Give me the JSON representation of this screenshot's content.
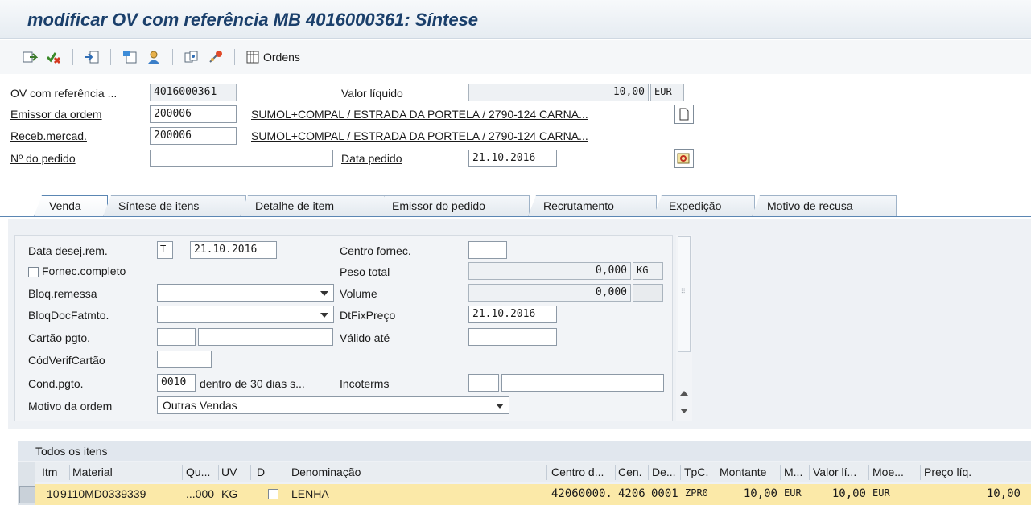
{
  "title": "modificar OV com referência MB 4016000361: Síntese",
  "toolbar": {
    "orders_label": "Ordens",
    "icons": [
      "display-change-icon",
      "cancel-red-check-icon",
      "import-icon",
      "header-icon",
      "person-icon",
      "document-flow-icon",
      "status-icon",
      "orders-grid-icon"
    ]
  },
  "header": {
    "ov_ref_label": "OV com referência ...",
    "ov_ref_value": "4016000361",
    "net_value_label": "Valor líquido",
    "net_value": "10,00",
    "net_currency": "EUR",
    "sold_to_label": "Emissor da ordem",
    "sold_to_value": "200006",
    "sold_to_text": "SUMOL+COMPAL / ESTRADA DA PORTELA / 2790-124 CARNA...",
    "ship_to_label": "Receb.mercad.",
    "ship_to_value": "200006",
    "ship_to_text": "SUMOL+COMPAL / ESTRADA DA PORTELA / 2790-124 CARNA...",
    "po_number_label": "Nº do pedido",
    "po_number_value": "",
    "po_date_label": "Data pedido",
    "po_date_value": "21.10.2016"
  },
  "tabs": [
    {
      "label": "Venda",
      "active": true
    },
    {
      "label": "Síntese de itens",
      "active": false
    },
    {
      "label": "Detalhe de item",
      "active": false
    },
    {
      "label": "Emissor do pedido",
      "active": false
    },
    {
      "label": "Recrutamento",
      "active": false
    },
    {
      "label": "Expedição",
      "active": false
    },
    {
      "label": "Motivo de recusa",
      "active": false
    }
  ],
  "sales": {
    "req_deliv_date_label": "Data desej.rem.",
    "req_deliv_date_type": "T",
    "req_deliv_date_value": "21.10.2016",
    "deliv_plant_label": "Centro fornec.",
    "deliv_plant_value": "",
    "complete_deliv_label": "Fornec.completo",
    "total_weight_label": "Peso total",
    "total_weight_value": "0,000",
    "total_weight_unit": "KG",
    "deliv_block_label": "Bloq.remessa",
    "deliv_block_value": "",
    "volume_label": "Volume",
    "volume_value": "0,000",
    "volume_unit": "",
    "billing_block_label": "BloqDocFatmto.",
    "billing_block_value": "",
    "pricing_date_label": "DtFixPreço",
    "pricing_date_value": "21.10.2016",
    "payment_card_label": "Cartão pgto.",
    "valid_to_label": "Válido até",
    "valid_to_value": "",
    "card_verif_label": "CódVerifCartão",
    "payment_terms_label": "Cond.pgto.",
    "payment_terms_value": "0010",
    "payment_terms_text": "dentro de 30 dias s...",
    "incoterms_label": "Incoterms",
    "order_reason_label": "Motivo da ordem",
    "order_reason_value": "Outras Vendas"
  },
  "items_table": {
    "title": "Todos os itens",
    "columns": [
      "Itm",
      "Material",
      "Qu...",
      "UV",
      "D",
      "Denominação",
      "Centro d...",
      "Cen.",
      "De...",
      "TpC.",
      "Montante",
      "M...",
      "Valor lí...",
      "Moe...",
      "Preço líq."
    ],
    "rows": [
      [
        "10",
        "9110MD0339339",
        "...000",
        "KG",
        "",
        "LENHA",
        "42060000...",
        "4206",
        "0001",
        "ZPR0",
        "10,00",
        "EUR",
        "10,00",
        "EUR",
        "10,00"
      ]
    ]
  }
}
